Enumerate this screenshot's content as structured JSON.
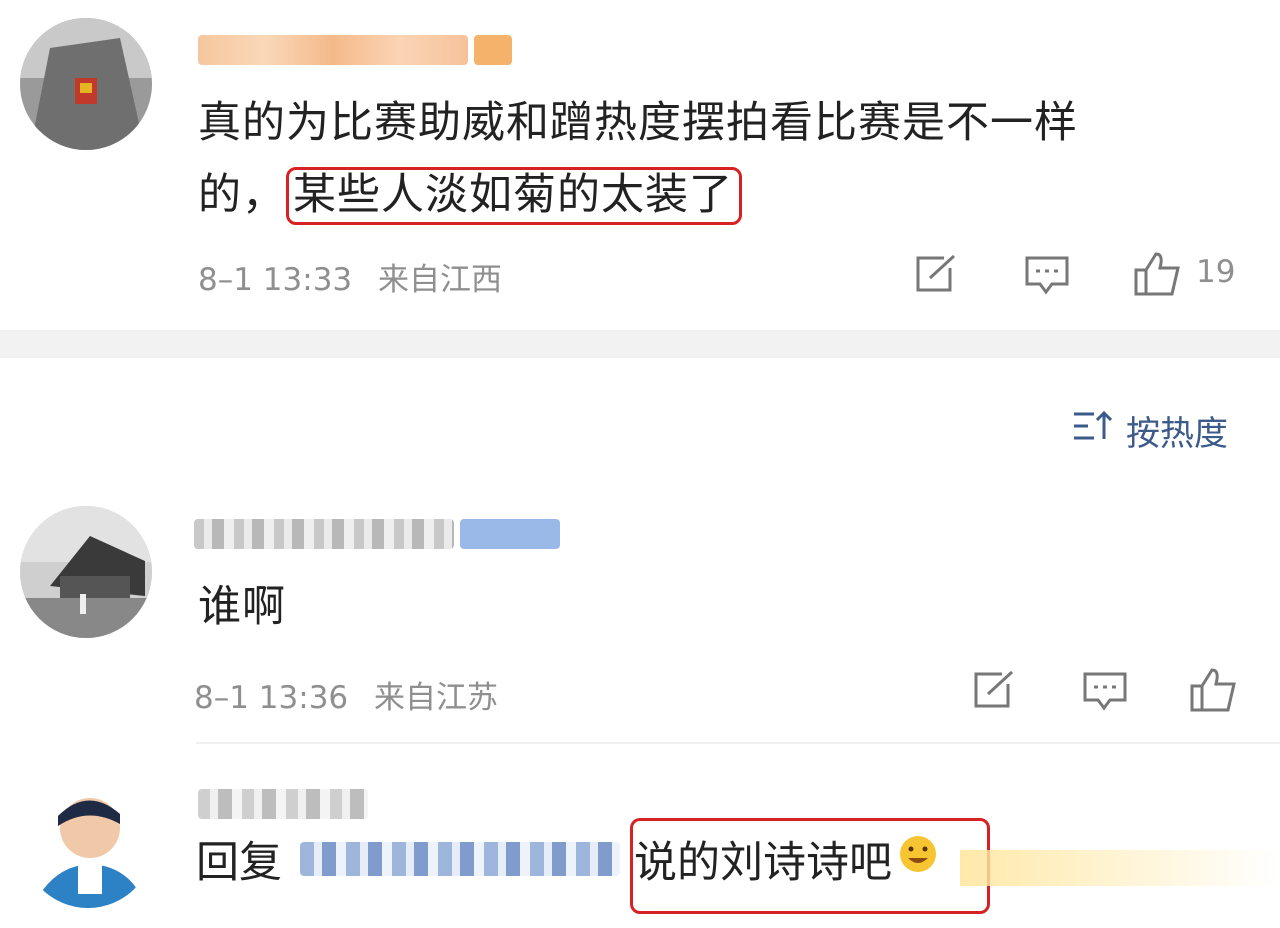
{
  "comments": [
    {
      "text_line1": "真的为比赛助威和蹭热度摆拍看比赛是不一样",
      "text_line2_prefix": "的，",
      "text_line2_highlight": "某些人淡如菊的太装了",
      "time": "8–1 13:33",
      "location": "来自江西",
      "likes": "19"
    }
  ],
  "sort": {
    "label": "按热度",
    "icon": "sort-icon"
  },
  "replies": [
    {
      "text": "谁啊",
      "time": "8–1 13:36",
      "location": "来自江苏"
    },
    {
      "prefix": "回复",
      "text": "说的刘诗诗吧"
    }
  ],
  "colors": {
    "highlight_border": "#d62222",
    "meta_text": "#8f8f8f",
    "link_blue": "#3c5a8a",
    "section_bg": "#f2f2f2"
  }
}
